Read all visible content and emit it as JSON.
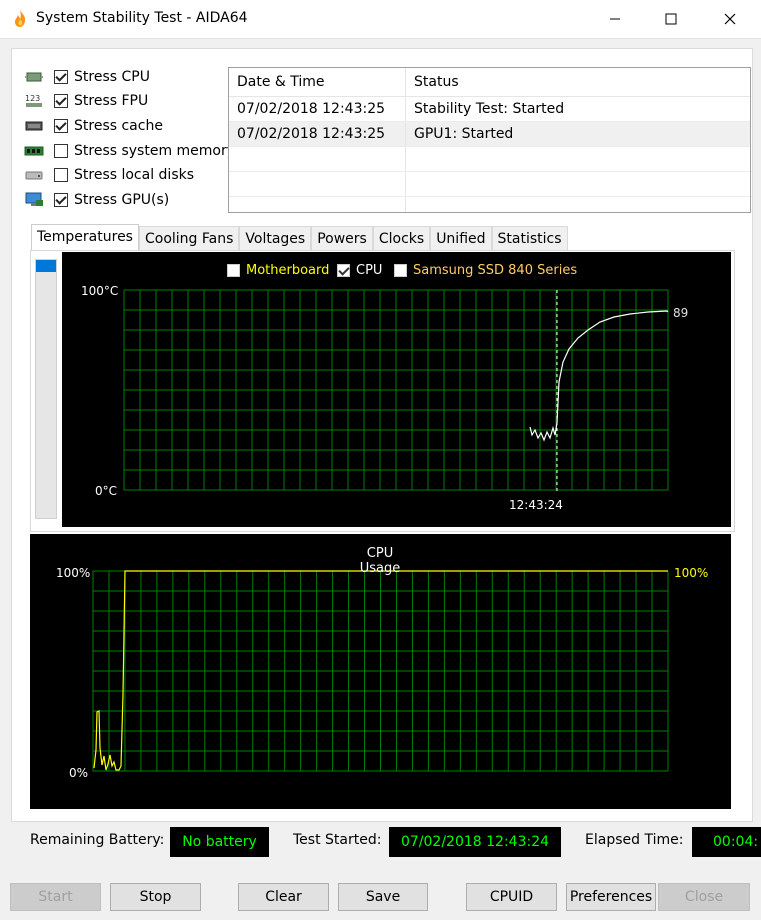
{
  "window": {
    "title": "System Stability Test - AIDA64"
  },
  "stress": [
    {
      "label": "Stress CPU",
      "checked": true,
      "icon": "cpu-chip-icon"
    },
    {
      "label": "Stress FPU",
      "checked": true,
      "icon": "fpu-123-icon"
    },
    {
      "label": "Stress cache",
      "checked": true,
      "icon": "cache-chip-icon"
    },
    {
      "label": "Stress system memory",
      "checked": false,
      "icon": "memory-module-icon"
    },
    {
      "label": "Stress local disks",
      "checked": false,
      "icon": "disk-drive-icon"
    },
    {
      "label": "Stress GPU(s)",
      "checked": true,
      "icon": "gpu-monitor-icon"
    }
  ],
  "log": {
    "headers": [
      "Date & Time",
      "Status"
    ],
    "rows": [
      {
        "time": "07/02/2018 12:43:25",
        "status": "Stability Test: Started"
      },
      {
        "time": "07/02/2018 12:43:25",
        "status": "GPU1: Started"
      }
    ]
  },
  "tabs": [
    "Temperatures",
    "Cooling Fans",
    "Voltages",
    "Powers",
    "Clocks",
    "Unified",
    "Statistics"
  ],
  "temp_graph": {
    "legend": [
      {
        "label": "Motherboard",
        "checked": false,
        "color": "#ffff00"
      },
      {
        "label": "CPU",
        "checked": true,
        "color": "#ffffff"
      },
      {
        "label": "Samsung SSD 840 Series",
        "checked": false,
        "color": "#ffcc66"
      }
    ],
    "y_max_label": "100°C",
    "y_min_label": "0°C",
    "time_label": "12:43:24",
    "current_value": "89"
  },
  "usage_graph": {
    "title": "CPU Usage",
    "y_max_label": "100%",
    "y_min_label": "0%",
    "current_value": "100%"
  },
  "status": {
    "battery_label": "Remaining Battery:",
    "battery_value": "No battery",
    "started_label": "Test Started:",
    "started_value": "07/02/2018 12:43:24",
    "elapsed_label": "Elapsed Time:",
    "elapsed_value": "00:04:"
  },
  "buttons": {
    "start": "Start",
    "stop": "Stop",
    "clear": "Clear",
    "save": "Save",
    "cpuid": "CPUID",
    "preferences": "Preferences",
    "close": "Close"
  },
  "colors": {
    "grid": "#008000",
    "temp_line": "#ffffff",
    "usage_line": "#ffff00",
    "status_text": "#00ff00",
    "accent": "#0078d7"
  }
}
